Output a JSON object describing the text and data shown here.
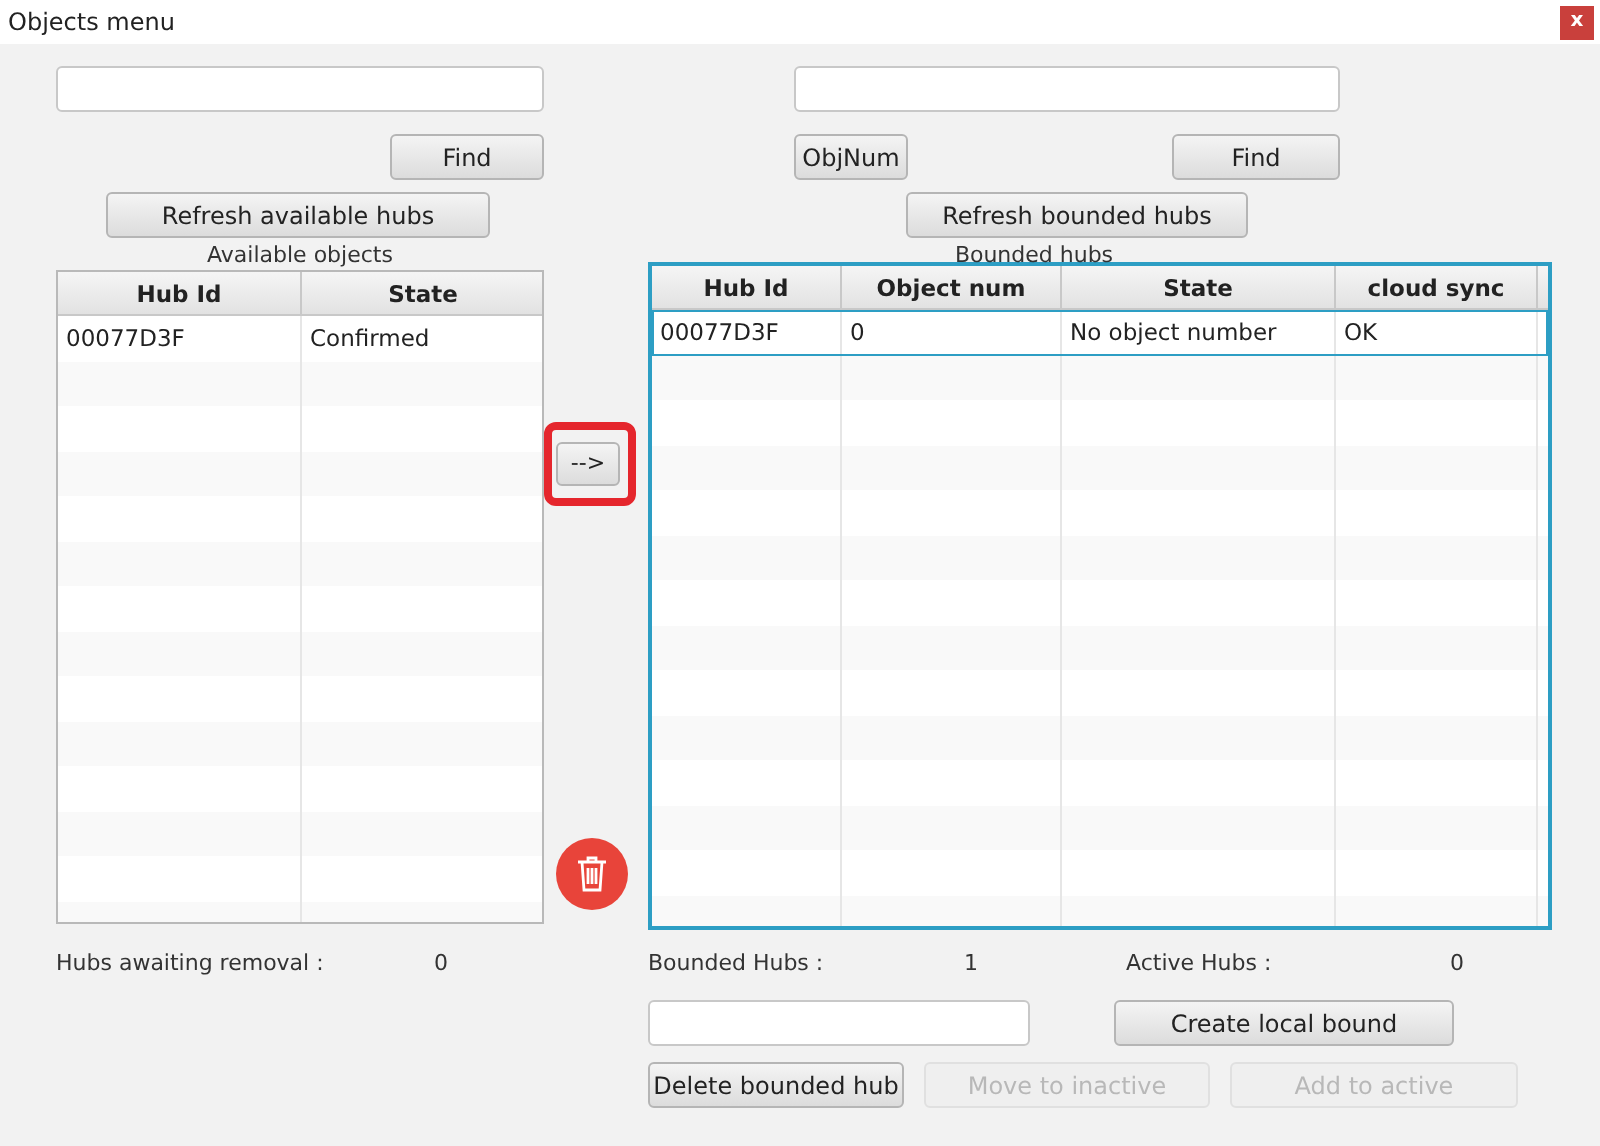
{
  "window": {
    "title": "Objects menu",
    "close_label": "x"
  },
  "available": {
    "find_button": {
      "label": "Find",
      "disabled": false
    },
    "refresh_button": {
      "label": "Refresh available hubs",
      "disabled": false
    },
    "table": {
      "title": "Available objects",
      "columns": [
        "Hub Id",
        "State"
      ],
      "rows": [
        {
          "cells": [
            "00077D3F",
            "Confirmed"
          ],
          "selected": false
        }
      ]
    },
    "status": {
      "label": "Hubs awaiting removal :",
      "value": "0"
    }
  },
  "transfer_button": {
    "label": "-->",
    "highlighted": true
  },
  "bounded": {
    "objnum_button": {
      "label": "ObjNum",
      "disabled": false
    },
    "find_button": {
      "label": "Find",
      "disabled": false
    },
    "refresh_button": {
      "label": "Refresh bounded hubs",
      "disabled": false
    },
    "table": {
      "title": "Bounded hubs",
      "columns": [
        "Hub Id",
        "Object num",
        "State",
        "cloud sync"
      ],
      "rows": [
        {
          "cells": [
            "00077D3F",
            "0",
            "No object number",
            "OK"
          ],
          "selected": true
        }
      ]
    },
    "counts": [
      {
        "label": "Bounded Hubs :",
        "value": "1"
      },
      {
        "label": "Active Hubs :",
        "value": "0"
      }
    ],
    "create_button": {
      "label": "Create local bound",
      "disabled": false
    },
    "actions": [
      {
        "label": "Delete bounded hub",
        "disabled": false
      },
      {
        "label": "Move to inactive",
        "disabled": true
      },
      {
        "label": "Add to active",
        "disabled": true
      }
    ]
  }
}
